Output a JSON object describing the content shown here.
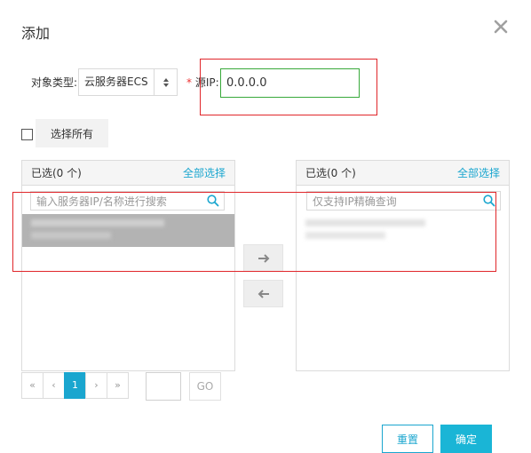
{
  "dialog": {
    "title": "添加",
    "close_icon": "close-icon"
  },
  "form": {
    "object_type_label": "对象类型:",
    "object_type_value": "云服务器ECS",
    "required_mark": "*",
    "source_ip_label": "源IP:",
    "source_ip_value": "0.0.0.0"
  },
  "select_all": {
    "label": "选择所有",
    "checked": false
  },
  "left_panel": {
    "count_label": "已选(0 个)",
    "select_all_label": "全部选择",
    "search_placeholder": "输入服务器IP/名称进行搜索"
  },
  "right_panel": {
    "count_label": "已选(0 个)",
    "select_all_label": "全部选择",
    "search_placeholder": "仅支持IP精确查询"
  },
  "transfer": {
    "move_right_icon": "arrow-right-icon",
    "move_left_icon": "arrow-left-icon"
  },
  "pagination": {
    "first": "«",
    "prev": "‹",
    "current": "1",
    "next": "›",
    "last": "»",
    "go_label": "GO"
  },
  "footer": {
    "reset_label": "重置",
    "confirm_label": "确定"
  },
  "colors": {
    "accent": "#1aa6cf",
    "primary_button": "#1ab5d6",
    "ip_border": "#38a93a",
    "annotation_red": "#e0262a"
  }
}
